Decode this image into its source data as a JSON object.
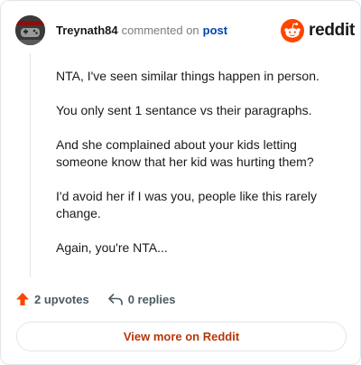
{
  "comment": {
    "username": "Treynath84",
    "action_text": "commented on",
    "post_link": "post",
    "paragraphs": [
      "NTA, I've seen similar things happen in person.",
      "You only sent 1 sentance vs their paragraphs.",
      "And she complained about your kids letting someone know that her kid was hurting them?",
      "I'd avoid her if I was you, people like this rarely change.",
      "Again, you're NTA..."
    ]
  },
  "brand": {
    "name": "reddit",
    "icon": "reddit-snoo-icon",
    "color": "#ff4500"
  },
  "footer": {
    "upvotes_label": "2 upvotes",
    "replies_label": "0 replies",
    "upvote_icon": "upvote-arrow-icon",
    "reply_icon": "reply-arrow-icon",
    "view_more_label": "View more on Reddit"
  },
  "colors": {
    "link": "#0045ac",
    "view_more": "#b8350b",
    "upvote": "#ff4500"
  }
}
